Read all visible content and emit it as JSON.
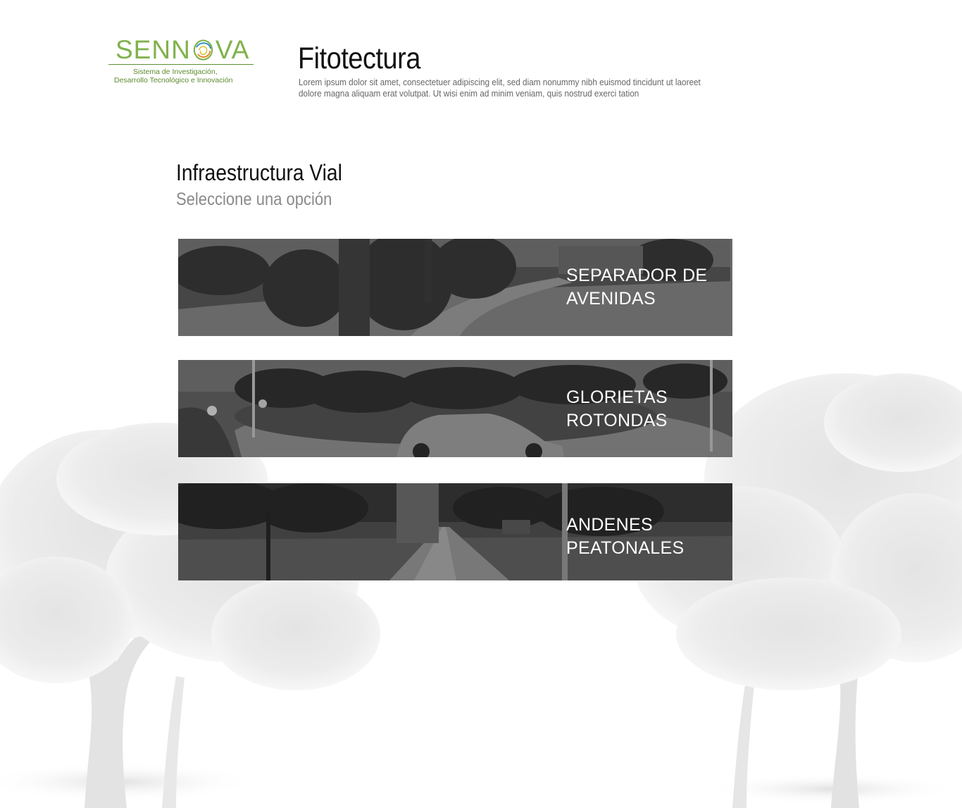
{
  "header": {
    "logo": {
      "wordmark": "SENNOVA",
      "tagline_line1": "Sistema de Investigación,",
      "tagline_line2": "Desarrollo Tecnológico e Innovación",
      "color": "#7fb24b"
    },
    "title": "Fitotectura",
    "description": "Lorem ipsum dolor sit amet, consectetuer adipiscing elit, sed diam nonummy nibh euismod tincidunt ut laoreet dolore magna aliquam erat volutpat. Ut wisi enim ad minim veniam, quis nostrud exerci tation"
  },
  "section": {
    "title": "Infraestructura Vial",
    "subtitle": "Seleccione una opción"
  },
  "options": [
    {
      "line1": "SEPARADOR DE",
      "line2": "AVENIDAS"
    },
    {
      "line1": "GLORIETAS",
      "line2": "ROTONDAS"
    },
    {
      "line1": "ANDENES",
      "line2": "PEATONALES"
    }
  ],
  "colors": {
    "background": "#ffffff",
    "text_primary": "#111111",
    "text_secondary": "#8a8a8a",
    "option_overlay": "#3a3a3a",
    "option_text": "#ffffff"
  }
}
